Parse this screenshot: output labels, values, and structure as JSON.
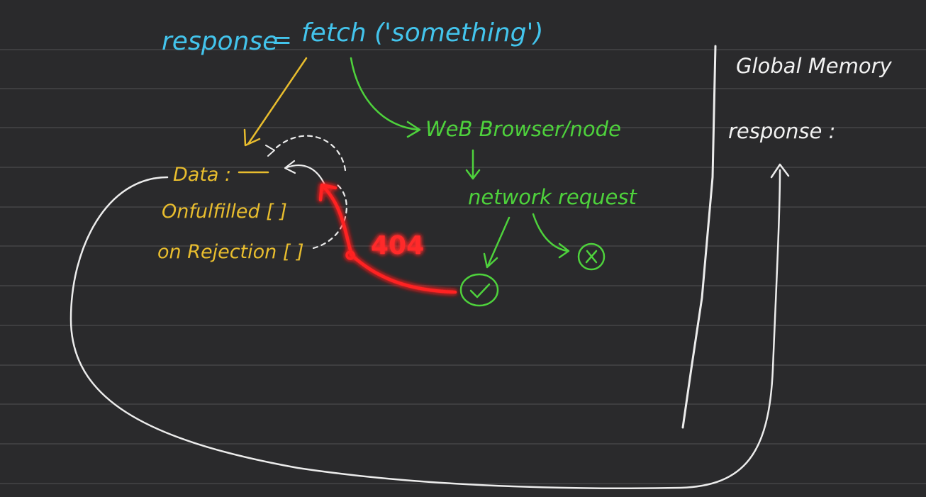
{
  "fetch_line": {
    "variable": "response",
    "equals": "=",
    "call": "fetch ('something')"
  },
  "promise_object": {
    "data_label": "Data :",
    "on_fulfilled_label": "Onfulfilled [ ]",
    "on_rejection_label": "on Rejection [ ]"
  },
  "browser_flow": {
    "browser_label": "WeB Browser/node",
    "network_label": "network request"
  },
  "status_code": "404",
  "global_memory": {
    "title": "Global Memory",
    "response_label": "response :"
  },
  "colors": {
    "background": "#2a2a2c",
    "blue_ink": "#43c4ec",
    "yellow_ink": "#e8bd2e",
    "green_ink": "#4ed23c",
    "red_ink": "#ff2a2a",
    "white_ink": "#f2f2f2"
  },
  "icons": {
    "success": "check-circle-icon",
    "failure": "x-circle-icon"
  }
}
